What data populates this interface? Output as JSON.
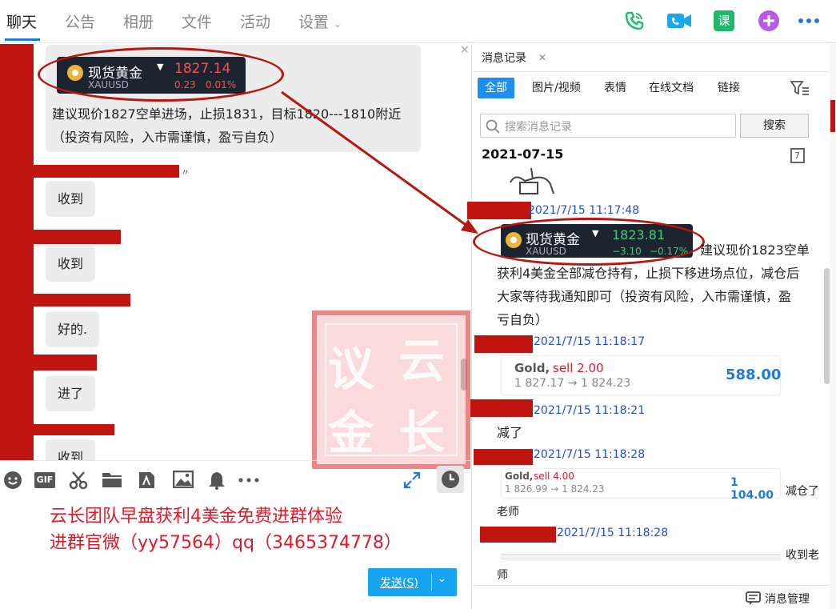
{
  "nav": {
    "tabs": [
      {
        "label": "聊天",
        "active": true
      },
      {
        "label": "公告"
      },
      {
        "label": "相册"
      },
      {
        "label": "文件"
      },
      {
        "label": "活动"
      },
      {
        "label": "设置"
      }
    ],
    "settings_chevron": "⌄",
    "course_label": "课",
    "icons": [
      "phone-icon",
      "video-icon",
      "course-icon",
      "add-icon",
      "more-icon"
    ]
  },
  "chat": {
    "ticker": {
      "name": "现货黄金",
      "symbol": "XAUUSD",
      "price": "1827.14",
      "change": "0.23",
      "change_pct": "0.01%",
      "price_color": "#ff4d4f"
    },
    "message1_line1": "建议现价1827空单进场，止损1831，目标1820---1810附近",
    "message1_line2": "（投资有风险，入市需谨慎，盈亏自负）",
    "mark": "〃",
    "replies": [
      "收到",
      "收到",
      "好的.",
      "进了",
      "收到"
    ],
    "watermark": [
      "议",
      "云",
      "金",
      "长"
    ]
  },
  "toolbar": {
    "icons": [
      "emoji-icon",
      "gif-icon",
      "scissors-icon",
      "folder-icon",
      "file-transfer-icon",
      "image-icon",
      "bell-icon",
      "more-icon"
    ],
    "gif_label": "GIF"
  },
  "promo": {
    "line1": "云长团队早盘获利4美金免费进群体验",
    "line2": "进群官微（yy57564）qq（3465374778）"
  },
  "send": {
    "label": "发送(S)"
  },
  "history": {
    "tab_label": "消息记录",
    "filters": [
      {
        "label": "全部",
        "active": true
      },
      {
        "label": "图片/视频"
      },
      {
        "label": "表情"
      },
      {
        "label": "在线文档"
      },
      {
        "label": "链接"
      }
    ],
    "search_placeholder": "搜索消息记录",
    "search_button": "搜索",
    "date": "2021-07-15",
    "calendar_day": "7",
    "entries": {
      "ts1": "2021/7/15 11:17:48",
      "ticker": {
        "name": "现货黄金",
        "symbol": "XAUUSD",
        "price": "1823.81",
        "change": "−3.10",
        "change_pct": "−0.17%",
        "price_color": "#39d07a"
      },
      "text1_lines": [
        "建议现价1823空单",
        "获利4美金全部减仓持有，止损下移进场点位，减仓后",
        "大家等待我通知即可（投资有风险，入市需谨慎，盈",
        "亏自负）"
      ],
      "ts2": "2021/7/15 11:18:17",
      "trade1": {
        "instrument": "Gold,",
        "side": "sell 2.00",
        "prices": "1 827.17 → 1 824.23",
        "profit": "588.00"
      },
      "ts3": "2021/7/15 11:18:21",
      "text2": "减了",
      "ts4": "2021/7/15 11:18:28",
      "trade2": {
        "instrument": "Gold,",
        "side": "sell 4.00",
        "prices": "1 826.99 → 1 824.23",
        "profit": "1 104.00"
      },
      "text3a": "减仓了",
      "text3b": "老师",
      "ts5": "2021/7/15 11:18:28",
      "text4a": "收到老",
      "text4b": "师"
    },
    "manage_label": "消息管理"
  },
  "colors": {
    "accent": "#1f8ef1",
    "redact": "#c0140e",
    "promo": "#e0192a",
    "annotation": "#b8170f"
  }
}
